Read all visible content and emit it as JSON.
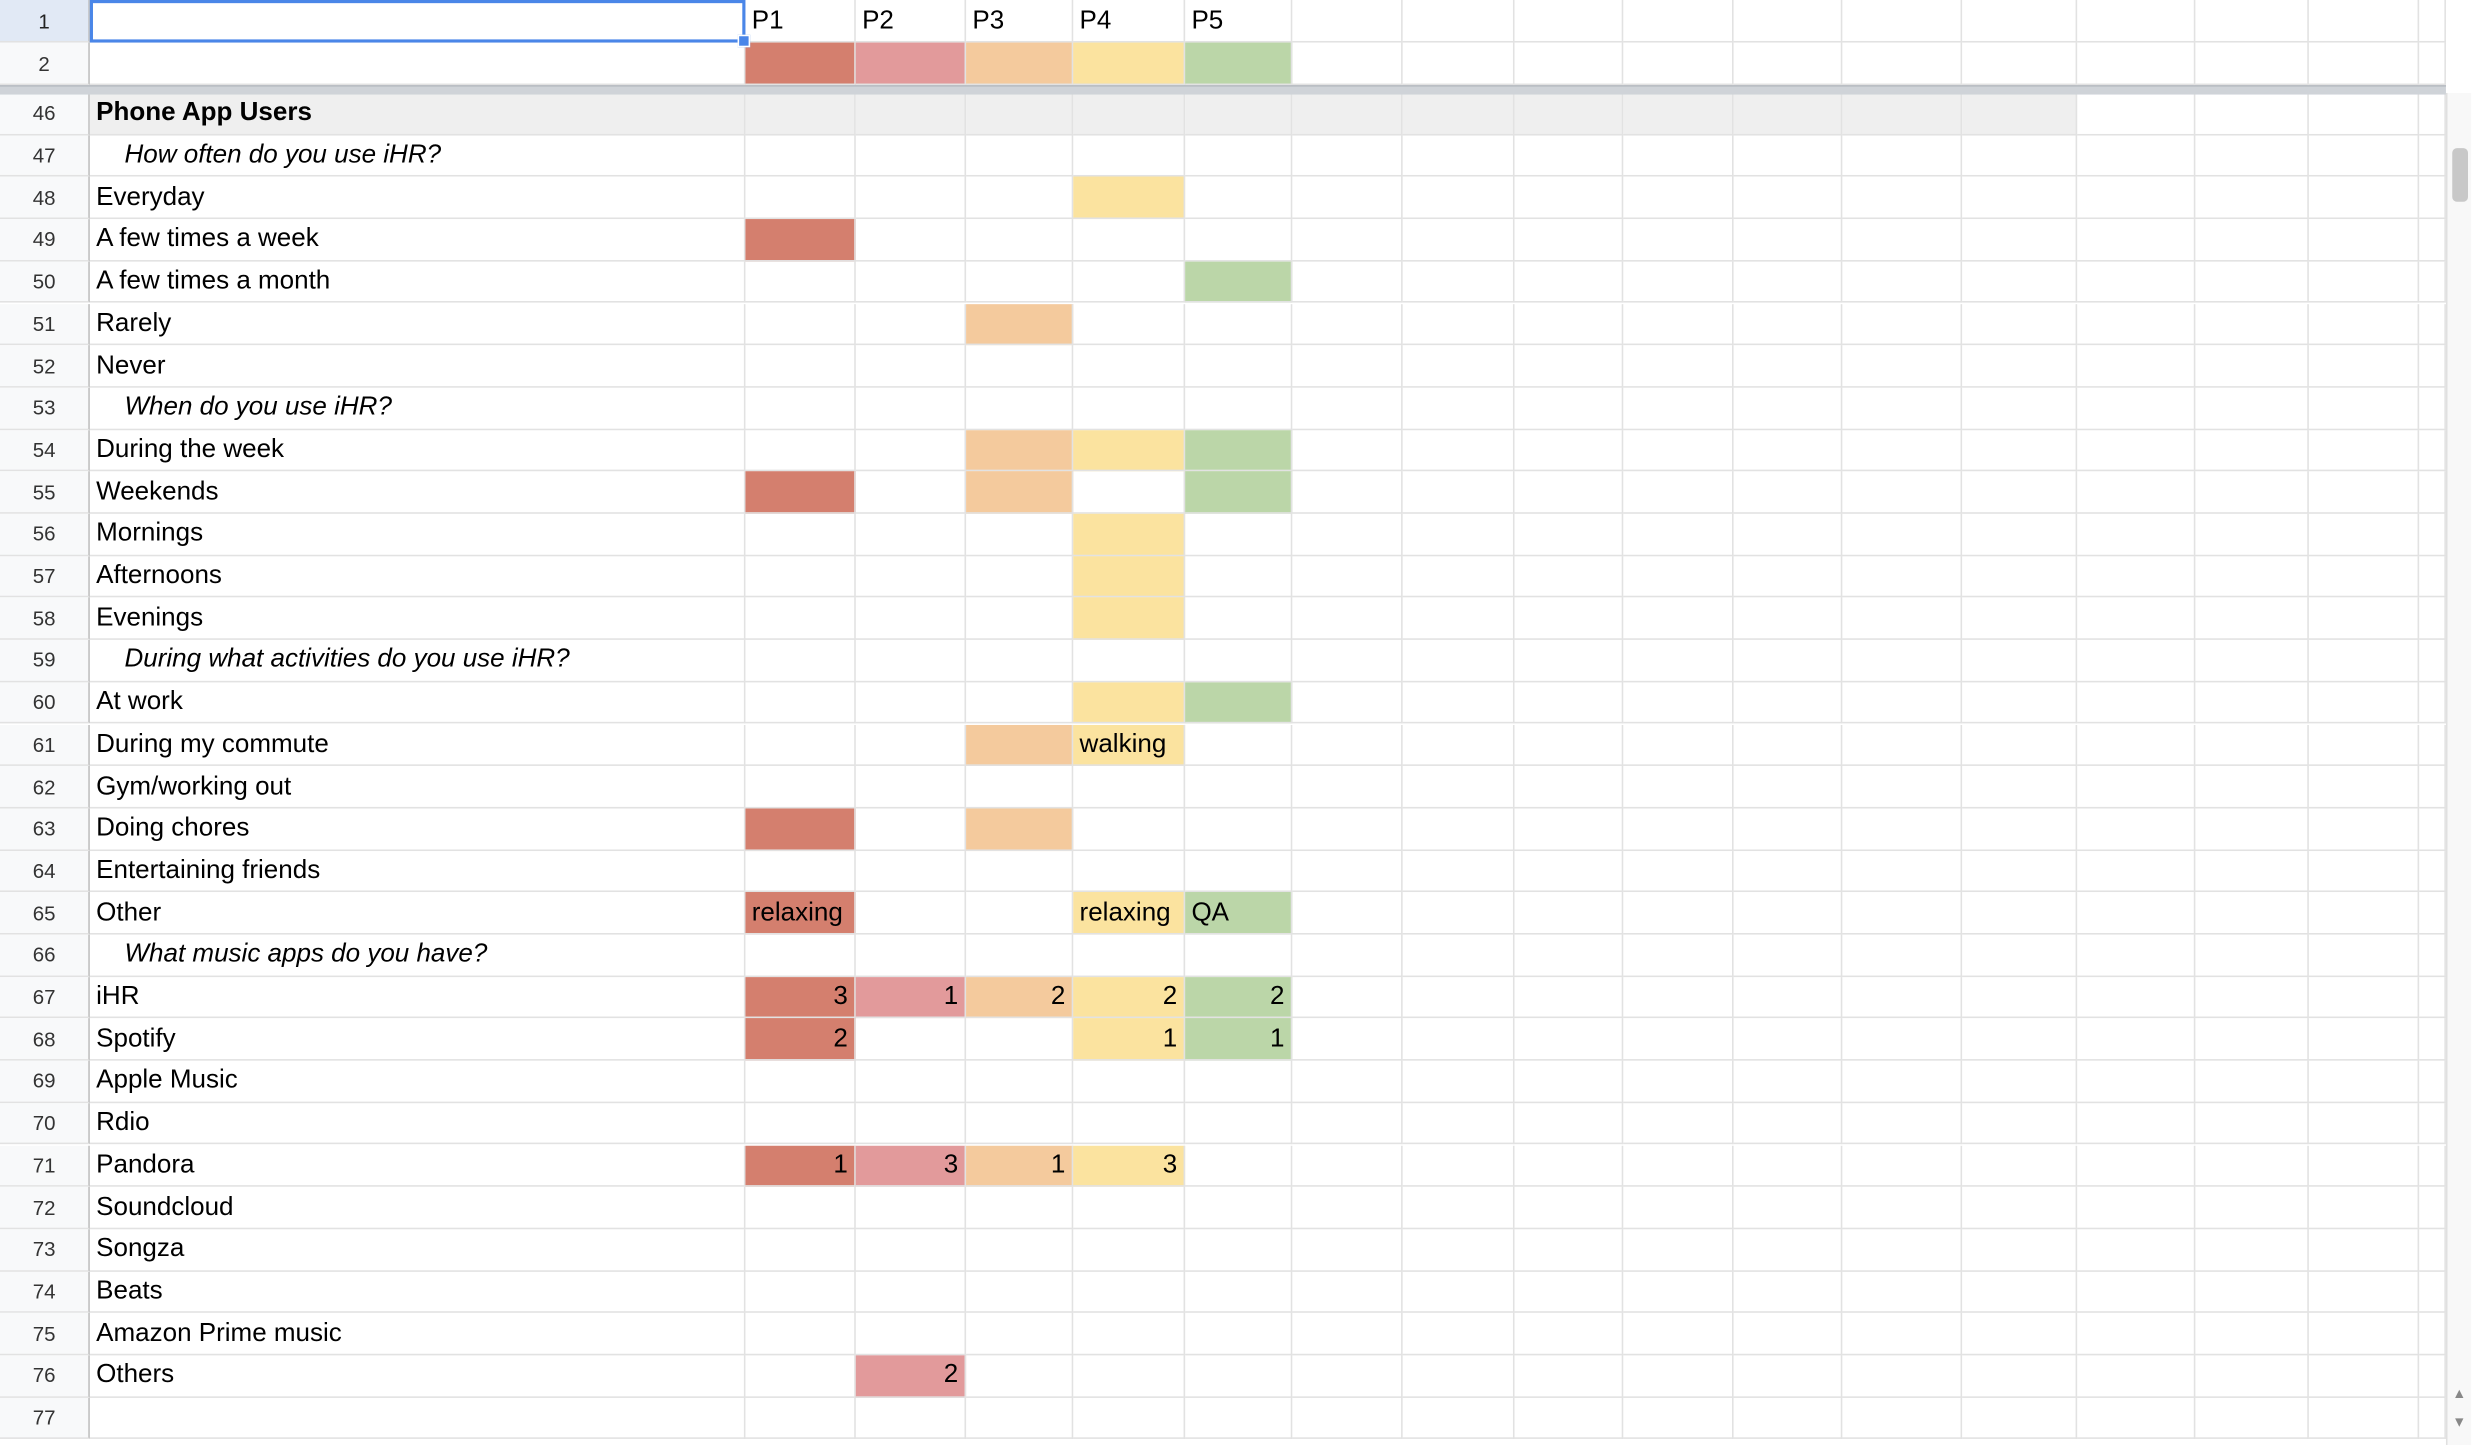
{
  "columns": [
    "",
    "P1",
    "P2",
    "P3",
    "P4",
    "P5",
    "",
    "",
    "",
    "",
    "",
    "",
    ""
  ],
  "header_rows": [
    {
      "num": "1",
      "cells": [
        "",
        "P1",
        "P2",
        "P3",
        "P4",
        "P5"
      ]
    },
    {
      "num": "2",
      "cells": [
        "",
        "",
        "",
        "",
        "",
        ""
      ]
    }
  ],
  "colors": {
    "P1": "#d47f6e",
    "P2": "#e29a9b",
    "P3": "#f4ca9d",
    "P4": "#fbe39f",
    "P5": "#bbd6a8",
    "section_bg": "#efefef",
    "selection": "#4a86e8"
  },
  "rows": [
    {
      "num": "46",
      "label": "Phone App Users",
      "style": "section",
      "cells": [
        "",
        "",
        "",
        "",
        ""
      ],
      "fill": []
    },
    {
      "num": "47",
      "label": "How often do you use iHR?",
      "style": "question",
      "cells": [
        "",
        "",
        "",
        "",
        ""
      ],
      "fill": []
    },
    {
      "num": "48",
      "label": "Everyday",
      "style": "plain",
      "cells": [
        "",
        "",
        "",
        "",
        ""
      ],
      "fill": [
        3
      ]
    },
    {
      "num": "49",
      "label": "A few times a week",
      "style": "plain",
      "cells": [
        "",
        "",
        "",
        "",
        ""
      ],
      "fill": [
        0
      ]
    },
    {
      "num": "50",
      "label": "A few times a month",
      "style": "plain",
      "cells": [
        "",
        "",
        "",
        "",
        ""
      ],
      "fill": [
        4
      ]
    },
    {
      "num": "51",
      "label": "Rarely",
      "style": "plain",
      "cells": [
        "",
        "",
        "",
        "",
        ""
      ],
      "fill": [
        2
      ]
    },
    {
      "num": "52",
      "label": "Never",
      "style": "plain",
      "cells": [
        "",
        "",
        "",
        "",
        ""
      ],
      "fill": []
    },
    {
      "num": "53",
      "label": "When do you use iHR?",
      "style": "question",
      "cells": [
        "",
        "",
        "",
        "",
        ""
      ],
      "fill": []
    },
    {
      "num": "54",
      "label": "During the week",
      "style": "plain",
      "cells": [
        "",
        "",
        "",
        "",
        ""
      ],
      "fill": [
        2,
        3,
        4
      ]
    },
    {
      "num": "55",
      "label": "Weekends",
      "style": "plain",
      "cells": [
        "",
        "",
        "",
        "",
        ""
      ],
      "fill": [
        0,
        2,
        4
      ]
    },
    {
      "num": "56",
      "label": "Mornings",
      "style": "plain",
      "cells": [
        "",
        "",
        "",
        "",
        ""
      ],
      "fill": [
        3
      ]
    },
    {
      "num": "57",
      "label": "Afternoons",
      "style": "plain",
      "cells": [
        "",
        "",
        "",
        "",
        ""
      ],
      "fill": [
        3
      ]
    },
    {
      "num": "58",
      "label": "Evenings",
      "style": "plain",
      "cells": [
        "",
        "",
        "",
        "",
        ""
      ],
      "fill": [
        3
      ]
    },
    {
      "num": "59",
      "label": "During what activities do you use iHR?",
      "style": "question",
      "cells": [
        "",
        "",
        "",
        "",
        ""
      ],
      "fill": []
    },
    {
      "num": "60",
      "label": "At work",
      "style": "plain",
      "cells": [
        "",
        "",
        "",
        "",
        ""
      ],
      "fill": [
        3,
        4
      ]
    },
    {
      "num": "61",
      "label": "During my commute",
      "style": "plain",
      "cells": [
        "",
        "",
        "",
        "walking",
        ""
      ],
      "fill": [
        2,
        3
      ]
    },
    {
      "num": "62",
      "label": "Gym/working out",
      "style": "plain",
      "cells": [
        "",
        "",
        "",
        "",
        ""
      ],
      "fill": []
    },
    {
      "num": "63",
      "label": "Doing chores",
      "style": "plain",
      "cells": [
        "",
        "",
        "",
        "",
        ""
      ],
      "fill": [
        0,
        2
      ]
    },
    {
      "num": "64",
      "label": "Entertaining friends",
      "style": "plain",
      "cells": [
        "",
        "",
        "",
        "",
        ""
      ],
      "fill": []
    },
    {
      "num": "65",
      "label": "Other",
      "style": "plain",
      "cells": [
        "relaxing",
        "",
        "",
        "relaxing",
        "QA"
      ],
      "fill": [
        0,
        3,
        4
      ]
    },
    {
      "num": "66",
      "label": "What music apps do you have?",
      "style": "question",
      "cells": [
        "",
        "",
        "",
        "",
        ""
      ],
      "fill": []
    },
    {
      "num": "67",
      "label": "iHR",
      "style": "plain",
      "cells": [
        "3",
        "1",
        "2",
        "2",
        "2"
      ],
      "fill": [
        0,
        1,
        2,
        3,
        4
      ]
    },
    {
      "num": "68",
      "label": "Spotify",
      "style": "plain",
      "cells": [
        "2",
        "",
        "",
        "1",
        "1"
      ],
      "fill": [
        0,
        3,
        4
      ]
    },
    {
      "num": "69",
      "label": "Apple Music",
      "style": "plain",
      "cells": [
        "",
        "",
        "",
        "",
        ""
      ],
      "fill": []
    },
    {
      "num": "70",
      "label": "Rdio",
      "style": "plain",
      "cells": [
        "",
        "",
        "",
        "",
        ""
      ],
      "fill": []
    },
    {
      "num": "71",
      "label": "Pandora",
      "style": "plain",
      "cells": [
        "1",
        "3",
        "1",
        "3",
        ""
      ],
      "fill": [
        0,
        1,
        2,
        3
      ]
    },
    {
      "num": "72",
      "label": "Soundcloud",
      "style": "plain",
      "cells": [
        "",
        "",
        "",
        "",
        ""
      ],
      "fill": []
    },
    {
      "num": "73",
      "label": "Songza",
      "style": "plain",
      "cells": [
        "",
        "",
        "",
        "",
        ""
      ],
      "fill": []
    },
    {
      "num": "74",
      "label": "Beats",
      "style": "plain",
      "cells": [
        "",
        "",
        "",
        "",
        ""
      ],
      "fill": []
    },
    {
      "num": "75",
      "label": "Amazon Prime music",
      "style": "plain",
      "cells": [
        "",
        "",
        "",
        "",
        ""
      ],
      "fill": []
    },
    {
      "num": "76",
      "label": "Others",
      "style": "plain",
      "cells": [
        "",
        "2",
        "",
        "",
        ""
      ],
      "fill": [
        1
      ]
    },
    {
      "num": "77",
      "label": "",
      "style": "plain",
      "cells": [
        "",
        "",
        "",
        "",
        ""
      ],
      "fill": []
    }
  ],
  "icons": {
    "scroll_up": "triangle-up-icon",
    "scroll_down": "triangle-down-icon"
  }
}
